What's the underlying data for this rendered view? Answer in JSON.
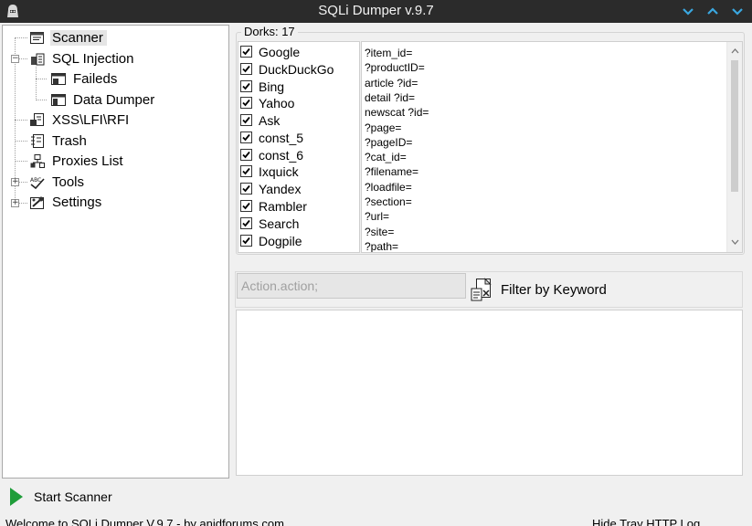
{
  "window": {
    "title": "SQLi Dumper v.9.7",
    "controls": [
      "chevron-down-icon",
      "chevron-up-icon",
      "chevron-down-icon"
    ]
  },
  "tree": {
    "items": [
      {
        "label": "Scanner",
        "icon": "scanner-icon",
        "selected": true
      },
      {
        "label": "SQL Injection",
        "icon": "database-icon"
      },
      {
        "label": "Faileds",
        "icon": "failed-icon"
      },
      {
        "label": "Data Dumper",
        "icon": "dumper-icon"
      },
      {
        "label": "XSS\\LFI\\RFI",
        "icon": "script-icon"
      },
      {
        "label": "Trash",
        "icon": "trash-icon"
      },
      {
        "label": "Proxies List",
        "icon": "proxy-icon"
      },
      {
        "label": "Tools",
        "icon": "tools-icon"
      },
      {
        "label": "Settings",
        "icon": "settings-icon"
      }
    ]
  },
  "dorks": {
    "label": "Dorks:",
    "count": "17",
    "engines": [
      {
        "label": "Google",
        "checked": true
      },
      {
        "label": "DuckDuckGo",
        "checked": true
      },
      {
        "label": "Bing",
        "checked": true
      },
      {
        "label": "Yahoo",
        "checked": true
      },
      {
        "label": "Ask",
        "checked": true
      },
      {
        "label": "const_5",
        "checked": true
      },
      {
        "label": "const_6",
        "checked": true
      },
      {
        "label": "Ixquick",
        "checked": true
      },
      {
        "label": "Yandex",
        "checked": true
      },
      {
        "label": "Rambler",
        "checked": true
      },
      {
        "label": "Search",
        "checked": true
      },
      {
        "label": "Dogpile",
        "checked": true
      }
    ],
    "params": [
      "?item_id=",
      "?productID=",
      "article ?id=",
      "detail ?id=",
      "newscat ?id=",
      "?page=",
      "?pageID=",
      "?cat_id=",
      "?filename=",
      "?loadfile=",
      "?section=",
      "?url=",
      "?site=",
      "?path="
    ]
  },
  "action": {
    "placeholder": "Action.action;",
    "filter_label": "Filter by Keyword"
  },
  "start": {
    "label": "Start Scanner"
  },
  "status": {
    "left": "Welcome to SQLi Dumper V.9.7 - by anidforums.com",
    "right": "Hide Tray   HTTP Log"
  }
}
